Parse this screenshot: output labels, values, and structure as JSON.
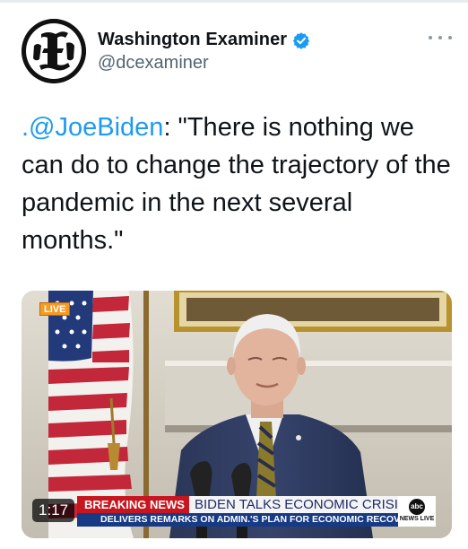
{
  "account": {
    "name": "Washington Examiner",
    "handle": "@dcexaminer",
    "avatar_letter": "E",
    "verified_color": "#1d9bf0"
  },
  "menu": {
    "more_icon": "more-horizontal-icon"
  },
  "tweet": {
    "mention": ".@JoeBiden",
    "text": ": \"There is nothing we can do to change the trajectory of the pandemic in the next several months.\""
  },
  "video": {
    "live_label": "LIVE",
    "duration": "1:17",
    "breaking_label": "BREAKING NEWS",
    "headline": "BIDEN TALKS ECONOMIC CRISIS",
    "subheadline": "DELIVERS REMARKS ON ADMIN.'S PLAN FOR ECONOMIC RECOVERY",
    "network": "abc",
    "network_live": "NEWS LIVE"
  },
  "colors": {
    "accent": "#1d9bf0",
    "ticker_red": "#c7161f",
    "ticker_blue": "#173a85"
  }
}
